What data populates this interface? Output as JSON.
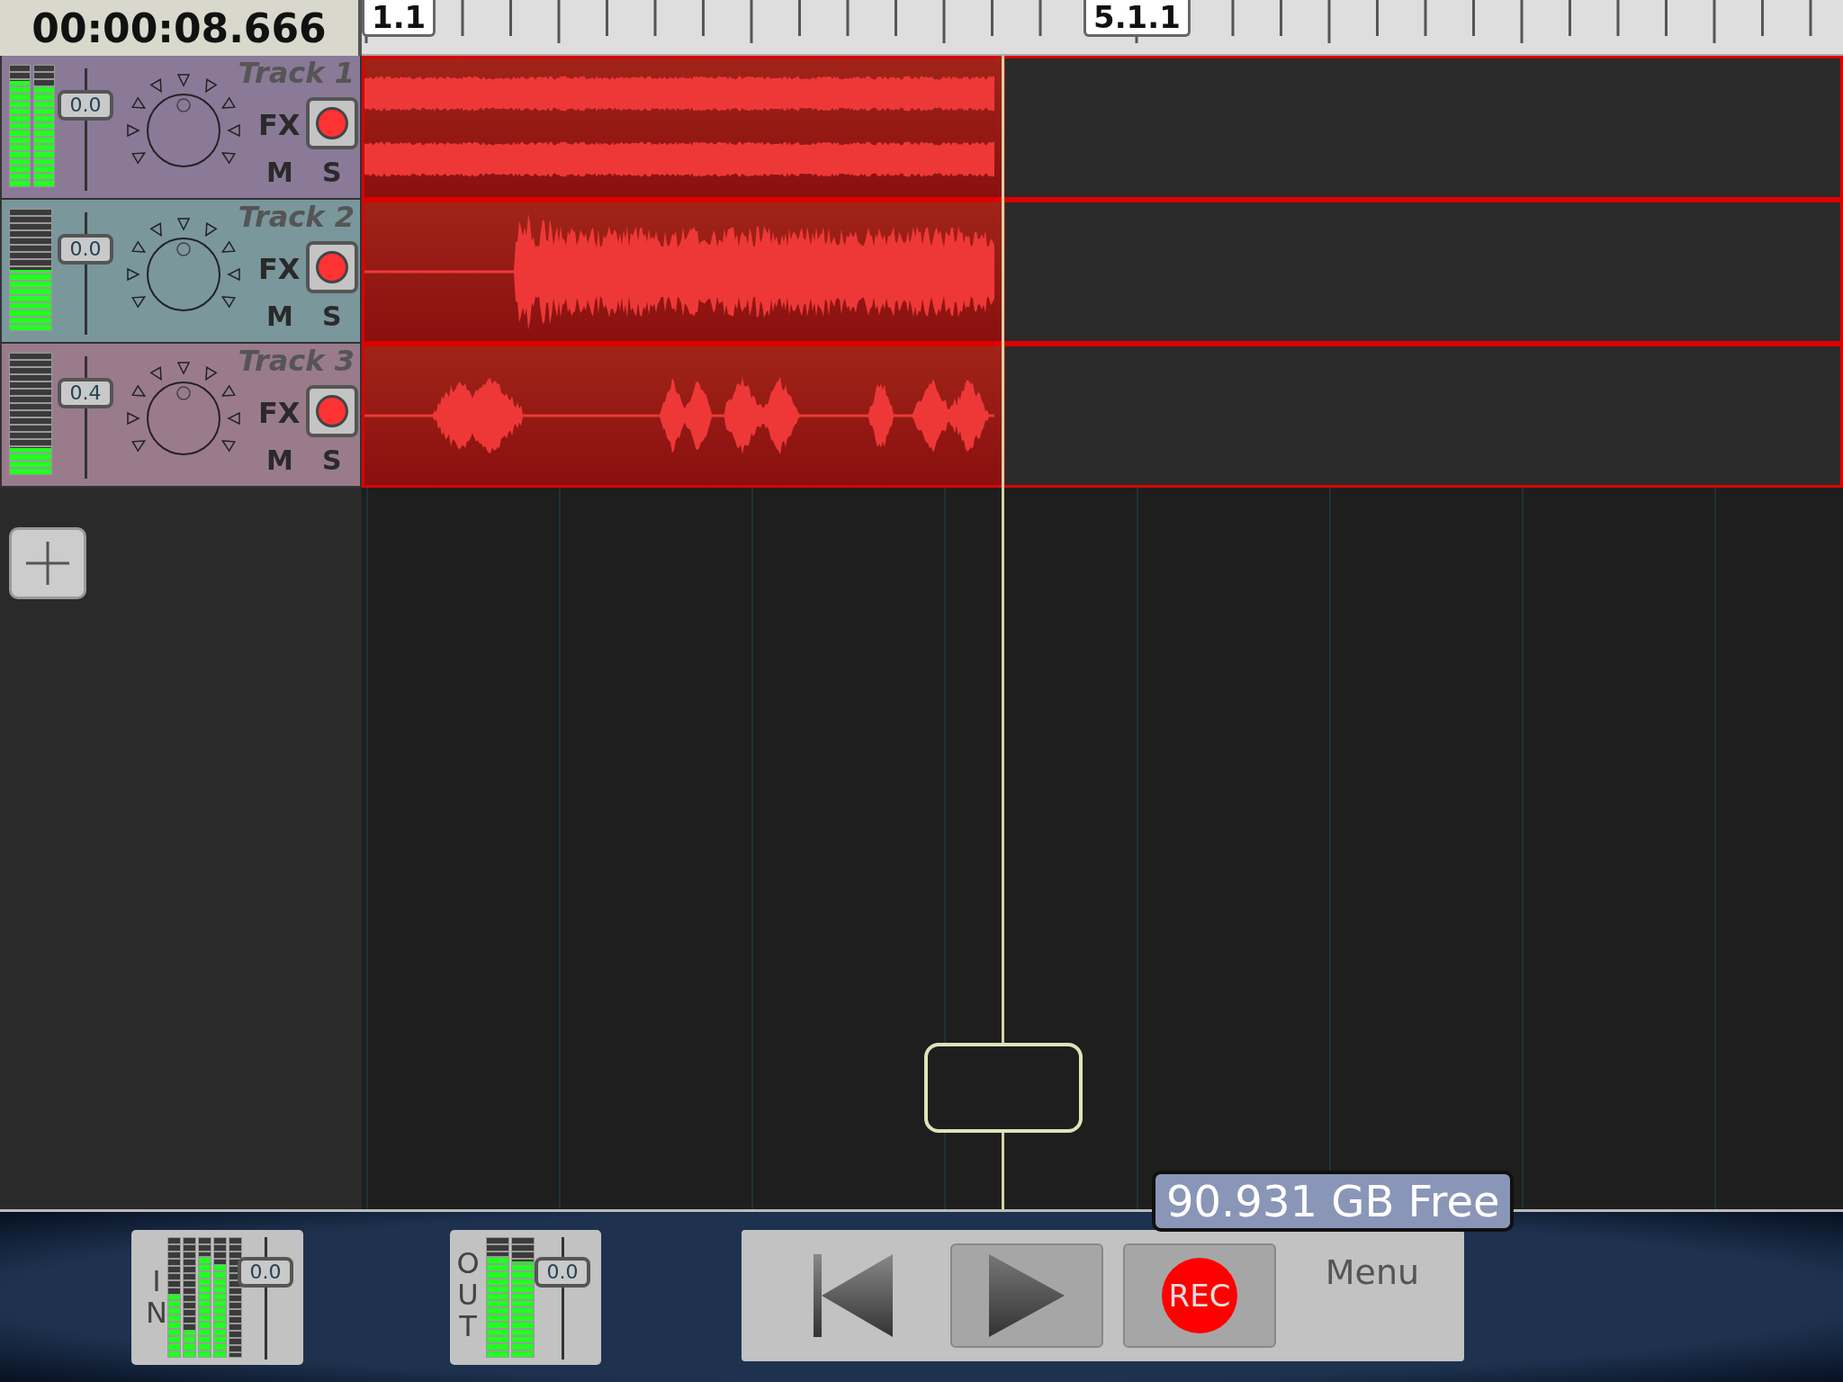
{
  "time": "00:00:08.666",
  "ruler": {
    "markers": [
      "1.1",
      "5.1.1"
    ]
  },
  "tracks": [
    {
      "name": "Track 1",
      "volume": "0.0",
      "color": "#8a7a98",
      "meters": [
        {
          "level": 0.87
        },
        {
          "level": 0.83
        }
      ],
      "fx": "FX",
      "mute": "M",
      "solo": "S"
    },
    {
      "name": "Track 2",
      "volume": "0.0",
      "color": "#7a979c",
      "meters": [
        {
          "level": 0.5
        }
      ],
      "fx": "FX",
      "mute": "M",
      "solo": "S"
    },
    {
      "name": "Track 3",
      "volume": "0.4",
      "color": "#9a7b8c",
      "meters": [
        {
          "level": 0.22
        }
      ],
      "fx": "FX",
      "mute": "M",
      "solo": "S"
    }
  ],
  "input": {
    "label": "IN",
    "volume": "0.0",
    "meters": [
      {
        "level": 0.52
      },
      {
        "level": 0.22
      },
      {
        "level": 0.85
      },
      {
        "level": 0.78
      },
      {
        "level": 0
      }
    ]
  },
  "output": {
    "label": "OUT",
    "volume": "0.0",
    "meters": [
      {
        "level": 0.85
      },
      {
        "level": 0.8
      }
    ]
  },
  "storage": "90.931 GB Free",
  "transport": {
    "record": "REC",
    "menu": "Menu"
  }
}
